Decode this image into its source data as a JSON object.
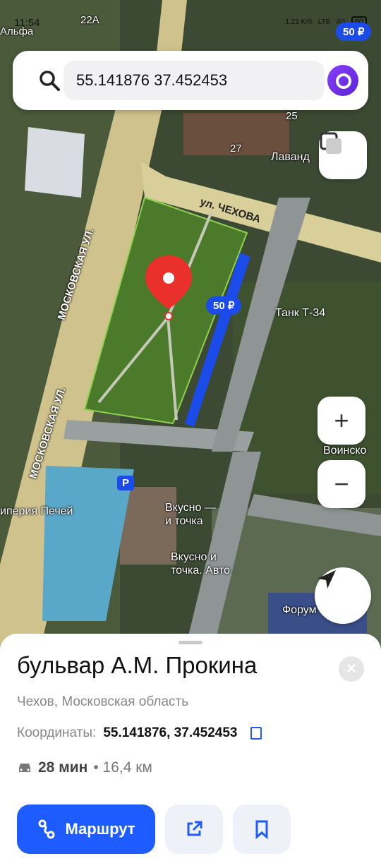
{
  "status": {
    "time": "11:54",
    "network": "1.21 K/S",
    "lte": "LTE",
    "signal": "4G",
    "battery": "60"
  },
  "search": {
    "value": "55.141876 37.452453"
  },
  "map": {
    "labels": {
      "alfa": "Альфа",
      "route22a": "22A",
      "chekhova": "ул. ЧЕХОВА",
      "moskovskaya1": "МОСКОВСКАЯ УЛ.",
      "moskovskaya2": "МОСКОВСКАЯ УЛ.",
      "lavanda": "Лаванд",
      "n25": "25",
      "n27": "27",
      "tank": "Танк Т-34",
      "imperiya": "иперия Печей",
      "vkusno1": "Вкусно —\nи точка",
      "vkusno2": "Вкусно и\nточка. Авто",
      "forum": "Форум",
      "voinsk": "Воинско",
      "price_top": "50 ₽",
      "price_mid": "50 ₽",
      "parking": "P"
    }
  },
  "place": {
    "title": "бульвар А.М. Прокина",
    "subtitle": "Чехов, Московская область",
    "coords_label": "Координаты:",
    "coords_value": "55.141876, 37.452453",
    "drive_time": "28 мин",
    "distance": "• 16,4 км",
    "route_button": "Маршрут"
  },
  "colors": {
    "accent": "#1f5cff",
    "pin": "#e9302a",
    "parking_zone": "#1b4be8"
  }
}
